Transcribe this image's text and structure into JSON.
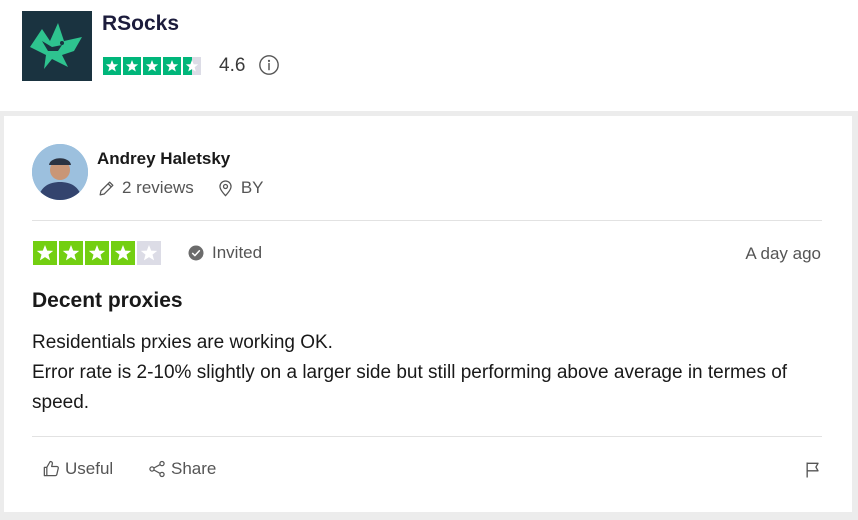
{
  "company": {
    "name": "RSocks",
    "rating": "4.6",
    "stars_filled": 4.5,
    "stars_total": 5
  },
  "review": {
    "reviewer_name": "Andrey Haletsky",
    "reviews_count": "2 reviews",
    "country": "BY",
    "rating": 4,
    "rating_total": 5,
    "invited_label": "Invited",
    "date": "A day ago",
    "title": "Decent proxies",
    "body_lines": [
      "Residentials prxies are working OK.",
      "Error rate is 2-10% slightly on a larger side but still performing above average in termes of speed."
    ]
  },
  "actions": {
    "useful_label": "Useful",
    "share_label": "Share"
  },
  "colors": {
    "trustpilot_green": "#00b67a",
    "review_star_green": "#73cf11",
    "empty_star": "#dcdce6"
  }
}
